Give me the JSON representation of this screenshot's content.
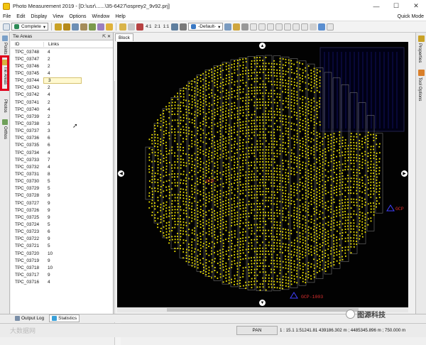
{
  "window": {
    "title": "Photo Measurement 2019 - [D:\\usr\\......\\35-6427\\osprey2_9v92.prj]",
    "minimize": "—",
    "maximize": "☐",
    "close": "✕"
  },
  "menu": {
    "items": [
      "File",
      "Edit",
      "Display",
      "View",
      "Options",
      "Window",
      "Help"
    ],
    "quick_mode": "Quick Mode"
  },
  "toolbar": {
    "status_combo": "Complete",
    "scale_labels": [
      "4:1",
      "2:1",
      "1:1"
    ],
    "style_combo": "-Default-"
  },
  "left_tabs": [
    "Points",
    "Tie Areas",
    "Photos",
    "Orthos"
  ],
  "tie_areas_panel": {
    "title": "Tie Areas",
    "header_buttons": "⇱ ✕",
    "columns": [
      "ID",
      "Links"
    ],
    "rows": [
      {
        "id": "TPC_03748",
        "links": "4"
      },
      {
        "id": "TPC_03747",
        "links": "2"
      },
      {
        "id": "TPC_03746",
        "links": "2"
      },
      {
        "id": "TPC_03745",
        "links": "4"
      },
      {
        "id": "TPC_03744",
        "links": "3"
      },
      {
        "id": "TPC_03743",
        "links": "2"
      },
      {
        "id": "TPC_03742",
        "links": "4"
      },
      {
        "id": "TPC_03741",
        "links": "2"
      },
      {
        "id": "TPC_03740",
        "links": "4"
      },
      {
        "id": "TPC_03739",
        "links": "2"
      },
      {
        "id": "TPC_03738",
        "links": "3"
      },
      {
        "id": "TPC_03737",
        "links": "3"
      },
      {
        "id": "TPC_03736",
        "links": "6"
      },
      {
        "id": "TPC_03735",
        "links": "6"
      },
      {
        "id": "TPC_03734",
        "links": "4"
      },
      {
        "id": "TPC_03733",
        "links": "7"
      },
      {
        "id": "TPC_03732",
        "links": "4"
      },
      {
        "id": "TPC_03731",
        "links": "8"
      },
      {
        "id": "TPC_03730",
        "links": "5"
      },
      {
        "id": "TPC_03729",
        "links": "5"
      },
      {
        "id": "TPC_03728",
        "links": "9"
      },
      {
        "id": "TPC_03727",
        "links": "9"
      },
      {
        "id": "TPC_03726",
        "links": "9"
      },
      {
        "id": "TPC_03725",
        "links": "9"
      },
      {
        "id": "TPC_03724",
        "links": "5"
      },
      {
        "id": "TPC_03723",
        "links": "6"
      },
      {
        "id": "TPC_03722",
        "links": "9"
      },
      {
        "id": "TPC_03721",
        "links": "5"
      },
      {
        "id": "TPC_03720",
        "links": "10"
      },
      {
        "id": "TPC_03719",
        "links": "9"
      },
      {
        "id": "TPC_03718",
        "links": "10"
      },
      {
        "id": "TPC_03717",
        "links": "9"
      },
      {
        "id": "TPC_03716",
        "links": "4"
      }
    ],
    "selected_index": 4
  },
  "viewer": {
    "tab": "Block",
    "gcp_labels": [
      "GCP",
      "GCP-1003",
      "GCP-"
    ],
    "point_color": "#f2e600",
    "outline_color": "#8a8a8a"
  },
  "right_tabs": [
    "Properties",
    "Tool Options"
  ],
  "bottom_tabs": [
    "Output Log",
    "Statistics"
  ],
  "status": {
    "mode": "PAN",
    "coords": "1 : 15.1    1:51241.81    439186.302 m ; 4485345.896 m ; 750.000 m"
  },
  "watermarks": {
    "left": "大数据网",
    "right": "图源科技"
  }
}
